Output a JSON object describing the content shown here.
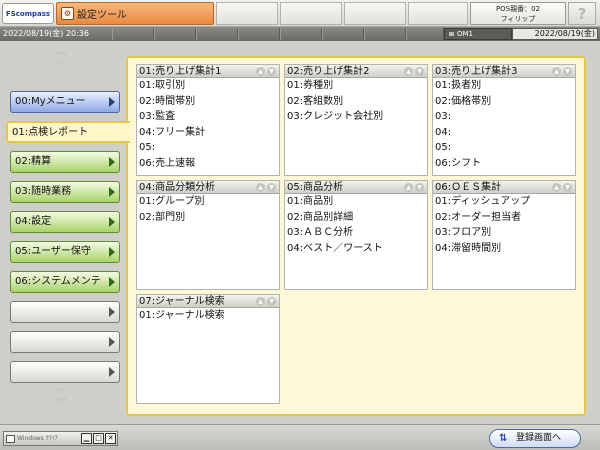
{
  "header": {
    "logo": "FScompass",
    "app_title": "設定ツール",
    "pos_line1": "POS親番：02",
    "pos_line2": "フィリップ",
    "help": "?"
  },
  "status": {
    "left_datetime": "2022/08/19(金) 20:36",
    "om": "OM1",
    "right_date": "2022/08/19(金)"
  },
  "sidebar": {
    "items": [
      {
        "label": "00:Myメニュー"
      },
      {
        "label": "01:点検レポート"
      },
      {
        "label": "02:精算"
      },
      {
        "label": "03:随時業務"
      },
      {
        "label": "04:設定"
      },
      {
        "label": "05:ユーザー保守"
      },
      {
        "label": "06:システムメンテ"
      },
      {
        "label": ""
      },
      {
        "label": ""
      },
      {
        "label": ""
      }
    ]
  },
  "panels": [
    {
      "title": "01:売り上げ集計1",
      "items": [
        "01:取引別",
        "02:時間帯別",
        "03:監査",
        "04:フリー集計",
        "05:",
        "06:売上速報"
      ]
    },
    {
      "title": "02:売り上げ集計2",
      "items": [
        "01:券種別",
        "02:客組数別",
        "03:クレジット会社別"
      ]
    },
    {
      "title": "03:売り上げ集計3",
      "items": [
        "01:扱者別",
        "02:価格帯別",
        "03:",
        "04:",
        "05:",
        "06:シフト"
      ]
    },
    {
      "title": "04:商品分類分析",
      "items": [
        "01:グループ別",
        "02:部門別"
      ]
    },
    {
      "title": "05:商品分析",
      "items": [
        "01:商品別",
        "02:商品別詳細",
        "03:ＡＢＣ分析",
        "04:ベスト／ワースト"
      ]
    },
    {
      "title": "06:ＯＥＳ集計",
      "items": [
        "01:ディッシュアップ",
        "02:オーダー担当者",
        "03:フロア別",
        "04:滞留時間別"
      ]
    },
    {
      "title": "07:ジャーナル検索",
      "items": [
        "01:ジャーナル検索"
      ]
    }
  ],
  "footer": {
    "windows_label": "Windows ｸﾗｲｱ",
    "register_button": "登録画面へ"
  }
}
